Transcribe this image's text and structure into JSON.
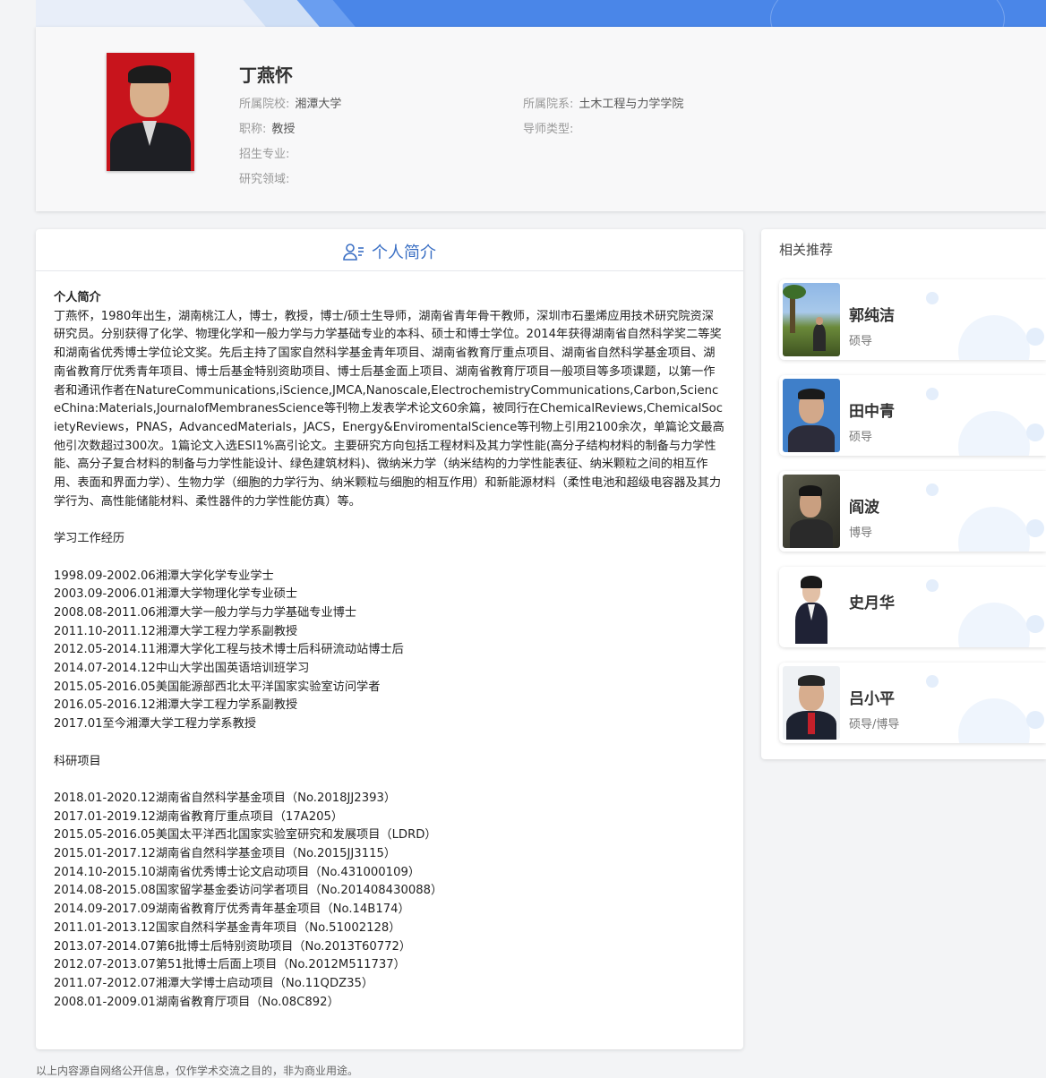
{
  "profile": {
    "name": "丁燕怀",
    "school_label": "所属院校:",
    "school": "湘潭大学",
    "dept_label": "所属院系:",
    "dept": "土木工程与力学学院",
    "title_label": "职称:",
    "title": "教授",
    "tutor_type_label": "导师类型:",
    "tutor_type": "",
    "major_label": "招生专业:",
    "major": "",
    "field_label": "研究领域:",
    "field": ""
  },
  "intro": {
    "header": "个人简介",
    "subheading": "个人简介",
    "paragraph": "丁燕怀，1980年出生，湖南桃江人，博士，教授，博士/硕士生导师，湖南省青年骨干教师，深圳市石墨烯应用技术研究院资深研究员。分别获得了化学、物理化学和一般力学与力学基础专业的本科、硕士和博士学位。2014年获得湖南省自然科学奖二等奖和湖南省优秀博士学位论文奖。先后主持了国家自然科学基金青年项目、湖南省教育厅重点项目、湖南省自然科学基金项目、湖南省教育厅优秀青年项目、博士后基金特别资助项目、博士后基金面上项目、湖南省教育厅项目一般项目等多项课题，以第一作者和通讯作者在NatureCommunications,iScience,JMCA,Nanoscale,ElectrochemistryCommunications,Carbon,ScienceChina:Materials,JournalofMembranesScience等刊物上发表学术论文60余篇，被同行在ChemicalReviews,ChemicalSocietyReviews，PNAS，AdvancedMaterials，JACS，Energy&EnviromentalScience等刊物上引用2100余次，单篇论文最高他引次数超过300次。1篇论文入选ESI1%高引论文。主要研究方向包括工程材料及其力学性能(高分子结构材料的制备与力学性能、高分子复合材料的制备与力学性能设计、绿色建筑材料)、微纳米力学（纳米结构的力学性能表征、纳米颗粒之间的相互作用、表面和界面力学）、生物力学（细胞的力学行为、纳米颗粒与细胞的相互作用）和新能源材料（柔性电池和超级电容器及其力学行为、高性能储能材料、柔性器件的力学性能仿真）等。",
    "experience_title": "学习工作经历",
    "experience": [
      "1998.09-2002.06湘潭大学化学专业学士",
      "2003.09-2006.01湘潭大学物理化学专业硕士",
      "2008.08-2011.06湘潭大学一般力学与力学基础专业博士",
      "2011.10-2011.12湘潭大学工程力学系副教授",
      "2012.05-2014.11湘潭大学化工程与技术博士后科研流动站博士后",
      "2014.07-2014.12中山大学出国英语培训班学习",
      "2015.05-2016.05美国能源部西北太平洋国家实验室访问学者",
      "2016.05-2016.12湘潭大学工程力学系副教授",
      "2017.01至今湘潭大学工程力学系教授"
    ],
    "projects_title": "科研项目",
    "projects": [
      "2018.01-2020.12湖南省自然科学基金项目（No.2018JJ2393）",
      "2017.01-2019.12湖南省教育厅重点项目（17A205）",
      "2015.05-2016.05美国太平洋西北国家实验室研究和发展项目（LDRD）",
      "2015.01-2017.12湖南省自然科学基金项目（No.2015JJ3115）",
      "2014.10-2015.10湖南省优秀博士论文启动项目（No.431000109）",
      "2014.08-2015.08国家留学基金委访问学者项目（No.201408430088）",
      "2014.09-2017.09湖南省教育厅优秀青年基金项目（No.14B174）",
      "2011.01-2013.12国家自然科学基金青年项目（No.51002128）",
      "2013.07-2014.07第6批博士后特别资助项目（No.2013T60772）",
      "2012.07-2013.07第51批博士后面上项目（No.2012M511737）",
      "2011.07-2012.07湘潭大学博士启动项目（No.11QDZ35）",
      "2008.01-2009.01湖南省教育厅项目（No.08C892）"
    ]
  },
  "recommend": {
    "title": "相关推荐",
    "items": [
      {
        "name": "郭纯洁",
        "type": "硕导"
      },
      {
        "name": "田中青",
        "type": "硕导"
      },
      {
        "name": "阎波",
        "type": "博导"
      },
      {
        "name": "史月华",
        "type": ""
      },
      {
        "name": "吕小平",
        "type": "硕导/博导"
      }
    ]
  },
  "footer": {
    "text": "以上内容源自网络公开信息，仅作学术交流之目的，非为商业用途。"
  },
  "colors": {
    "accent": "#3a6fc4",
    "banner": "#4a86e8"
  },
  "icons": {
    "intro_header": "user-list-icon"
  }
}
